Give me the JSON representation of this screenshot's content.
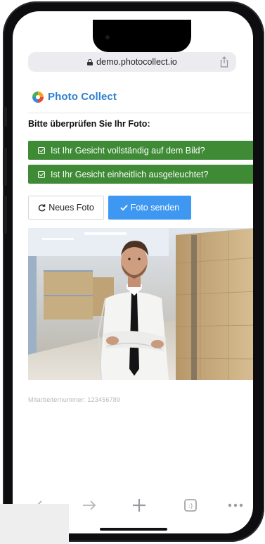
{
  "browser": {
    "url": "demo.photocollect.io"
  },
  "app": {
    "brand_name": "Photo Collect",
    "heading": "Bitte überprüfen Sie Ihr Foto:",
    "checks": [
      "Ist Ihr Gesicht vollständig auf dem Bild?",
      "Ist Ihr Gesicht einheitlich ausgeleuchtet?"
    ],
    "new_photo_label": "Neues Foto",
    "send_photo_label": "Foto senden",
    "caption": "Mitarbeiternummer: 123456789"
  },
  "colors": {
    "accent_blue": "#3e97f0",
    "check_green": "#3e8a35",
    "brand_blue": "#2d7fd0"
  },
  "icons": {
    "lock": "lock-icon",
    "share": "share-icon",
    "refresh": "refresh-icon",
    "checkmark": "checkmark-icon",
    "back": "back-arrow-icon",
    "forward": "forward-arrow-icon",
    "new_tab": "plus-icon",
    "tabs": "tabs-icon",
    "more": "more-icon"
  }
}
